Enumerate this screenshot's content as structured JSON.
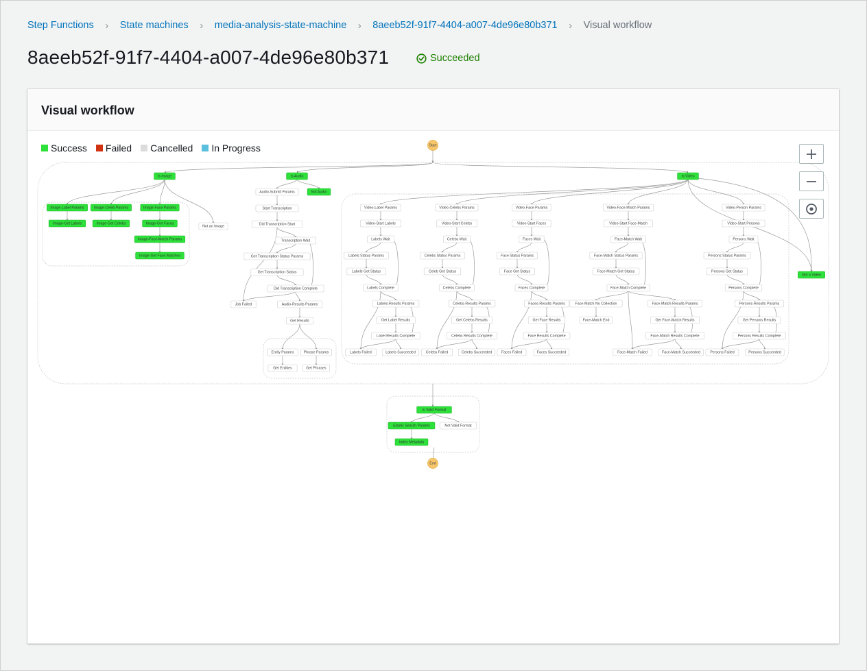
{
  "breadcrumb": {
    "items": [
      "Step Functions",
      "State machines",
      "media-analysis-state-machine",
      "8aeeb52f-91f7-4404-a007-4de96e80b371"
    ],
    "current": "Visual workflow"
  },
  "header": {
    "title": "8aeeb52f-91f7-4404-a007-4de96e80b371",
    "status": "Succeeded",
    "status_color": "#1d8102"
  },
  "panel": {
    "title": "Visual workflow"
  },
  "legend": [
    {
      "label": "Success",
      "color": "#2ee03a"
    },
    {
      "label": "Failed",
      "color": "#d13212"
    },
    {
      "label": "Cancelled",
      "color": "#dcdcdc"
    },
    {
      "label": "In Progress",
      "color": "#5bc0de"
    }
  ],
  "zoom_controls": [
    {
      "name": "zoom-in",
      "icon": "plus-icon"
    },
    {
      "name": "zoom-out",
      "icon": "minus-icon"
    },
    {
      "name": "center",
      "icon": "target-icon"
    }
  ],
  "workflow": {
    "nodes": [
      {
        "id": "start",
        "label": "Start",
        "terminal": true
      },
      {
        "id": "end",
        "label": "End",
        "terminal": true
      },
      {
        "id": "isimage",
        "label": "Is Image",
        "success": true
      },
      {
        "id": "isaudio",
        "label": "Is Audio",
        "success": true
      },
      {
        "id": "isvideo",
        "label": "Is Video",
        "success": true
      },
      {
        "id": "iml",
        "label": "Image-Label Params",
        "success": true
      },
      {
        "id": "imc",
        "label": "Image-Celeb Params",
        "success": true
      },
      {
        "id": "imf",
        "label": "Image-Face Params",
        "success": true
      },
      {
        "id": "imgl",
        "label": "Image-Get Labels",
        "success": true
      },
      {
        "id": "imgc",
        "label": "Image-Get Celebs",
        "success": true
      },
      {
        "id": "imgf",
        "label": "Image-Get Faces",
        "success": true
      },
      {
        "id": "imfm",
        "label": "Image-Face-Match Params",
        "success": true
      },
      {
        "id": "imgfm",
        "label": "Image-Get Face-Matches",
        "success": true
      },
      {
        "id": "notimage",
        "label": "Not an Image"
      },
      {
        "id": "asp",
        "label": "Audio-Submit Params"
      },
      {
        "id": "notaudio",
        "label": "Not Audio",
        "success": true
      },
      {
        "id": "st",
        "label": "Start Transcription"
      },
      {
        "id": "dts",
        "label": "Did Transcription Start"
      },
      {
        "id": "tw",
        "label": "Transcription Wait"
      },
      {
        "id": "gtsp",
        "label": "Get Transcription Status Params"
      },
      {
        "id": "gts",
        "label": "Get Transcription Status"
      },
      {
        "id": "dtc",
        "label": "Did Transcription Complete"
      },
      {
        "id": "jf",
        "label": "Job Failed"
      },
      {
        "id": "arp",
        "label": "Audio-Results Params"
      },
      {
        "id": "gr",
        "label": "Get Results"
      },
      {
        "id": "ep",
        "label": "Entity Params"
      },
      {
        "id": "pp",
        "label": "Phrase Params"
      },
      {
        "id": "ge",
        "label": "Get Entities"
      },
      {
        "id": "gp",
        "label": "Get Phrases"
      },
      {
        "id": "vlp",
        "label": "Video-Label Params"
      },
      {
        "id": "vsl",
        "label": "Video-Start Labels"
      },
      {
        "id": "lw",
        "label": "Labels Wait"
      },
      {
        "id": "lsp",
        "label": "Labels Status Params"
      },
      {
        "id": "lgs",
        "label": "Labels Get Status"
      },
      {
        "id": "lc",
        "label": "Labels Complete"
      },
      {
        "id": "lrp",
        "label": "Labels-Results Params"
      },
      {
        "id": "glr",
        "label": "Get Label Results"
      },
      {
        "id": "lrc",
        "label": "Label Results Complete"
      },
      {
        "id": "lf",
        "label": "Labels Failed"
      },
      {
        "id": "ls",
        "label": "Labels Succeeded"
      },
      {
        "id": "vcp",
        "label": "Video-Celebs Params"
      },
      {
        "id": "vsc",
        "label": "Video-Start Celebs"
      },
      {
        "id": "cw",
        "label": "Celebs Wait"
      },
      {
        "id": "csp",
        "label": "Celebs Status Params"
      },
      {
        "id": "cgs",
        "label": "Celeb Get Status"
      },
      {
        "id": "cc",
        "label": "Celebs Complete"
      },
      {
        "id": "crp",
        "label": "Celebs-Results Params"
      },
      {
        "id": "gcr",
        "label": "Get Celebs Results"
      },
      {
        "id": "crc",
        "label": "Celebs Results Complete"
      },
      {
        "id": "cf",
        "label": "Celebs Failed"
      },
      {
        "id": "cs",
        "label": "Celebs Succeeded"
      },
      {
        "id": "vfp",
        "label": "Video-Face Params"
      },
      {
        "id": "vsf",
        "label": "Video-Start Faces"
      },
      {
        "id": "fw",
        "label": "Faces Wait"
      },
      {
        "id": "fsp",
        "label": "Face Status Params"
      },
      {
        "id": "fgs",
        "label": "Face Get Status"
      },
      {
        "id": "fc",
        "label": "Faces Complete"
      },
      {
        "id": "frp",
        "label": "Faces-Results Params"
      },
      {
        "id": "gfr",
        "label": "Get Face Results"
      },
      {
        "id": "frc",
        "label": "Face Results Complete"
      },
      {
        "id": "ff",
        "label": "Faces Failed"
      },
      {
        "id": "fs",
        "label": "Faces Succeeded"
      },
      {
        "id": "vfmp",
        "label": "Video-Face-Match Params"
      },
      {
        "id": "vsfm",
        "label": "Video-Start Face-Match"
      },
      {
        "id": "fmw",
        "label": "Face-Match Wait"
      },
      {
        "id": "fmsp",
        "label": "Face-Match Status Params"
      },
      {
        "id": "fmgs",
        "label": "Face-Match Get Status"
      },
      {
        "id": "fmc",
        "label": "Face-Match Complete"
      },
      {
        "id": "fmnc",
        "label": "Face-Match No Collection"
      },
      {
        "id": "fmrp",
        "label": "Face-Match-Results Params"
      },
      {
        "id": "fme",
        "label": "Face-Match End"
      },
      {
        "id": "gfmr",
        "label": "Get Face-Match Results"
      },
      {
        "id": "fmrc",
        "label": "Face-Match Results Complete"
      },
      {
        "id": "fmf",
        "label": "Face-Match Failed"
      },
      {
        "id": "fms",
        "label": "Face-Match Succeeded"
      },
      {
        "id": "vpp",
        "label": "Video-Person Params"
      },
      {
        "id": "vsp",
        "label": "Video-Start Persons"
      },
      {
        "id": "pw",
        "label": "Persons Wait"
      },
      {
        "id": "psp",
        "label": "Persons Status Params"
      },
      {
        "id": "pgs",
        "label": "Persons Get Status"
      },
      {
        "id": "pc",
        "label": "Persons Complete"
      },
      {
        "id": "prp",
        "label": "Persons-Results Params"
      },
      {
        "id": "gpr",
        "label": "Get Persons Results"
      },
      {
        "id": "prc",
        "label": "Persons Results Complete"
      },
      {
        "id": "pf",
        "label": "Persons Failed"
      },
      {
        "id": "ps",
        "label": "Persons Succeeded"
      },
      {
        "id": "notvideo",
        "label": "Not a Video",
        "success": true
      },
      {
        "id": "ivf",
        "label": "Is Valid Format",
        "success": true
      },
      {
        "id": "esp",
        "label": "Elastic Search Params",
        "success": true
      },
      {
        "id": "nvf",
        "label": "Not Valid Format"
      },
      {
        "id": "im",
        "label": "Index Metadata",
        "success": true
      }
    ]
  }
}
